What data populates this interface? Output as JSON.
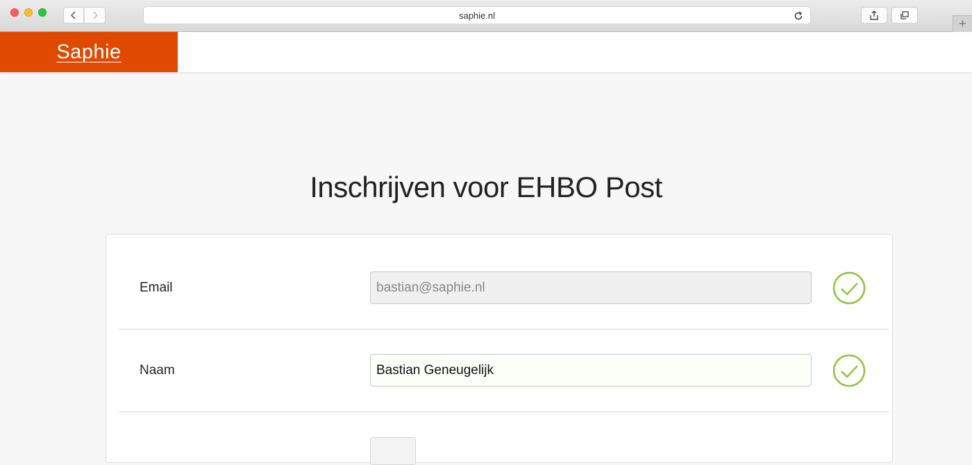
{
  "browser": {
    "url": "saphie.nl",
    "new_tab_label": "+"
  },
  "header": {
    "logo": "Saphie",
    "brand_color": "#e04a00"
  },
  "page": {
    "title": "Inschrijven voor EHBO Post"
  },
  "form": {
    "email": {
      "label": "Email",
      "value": "bastian@saphie.nl",
      "disabled": true,
      "status": "valid"
    },
    "naam": {
      "label": "Naam",
      "value": "Bastian Geneugelijk",
      "status": "valid"
    },
    "valid_color": "#8cc63f"
  }
}
